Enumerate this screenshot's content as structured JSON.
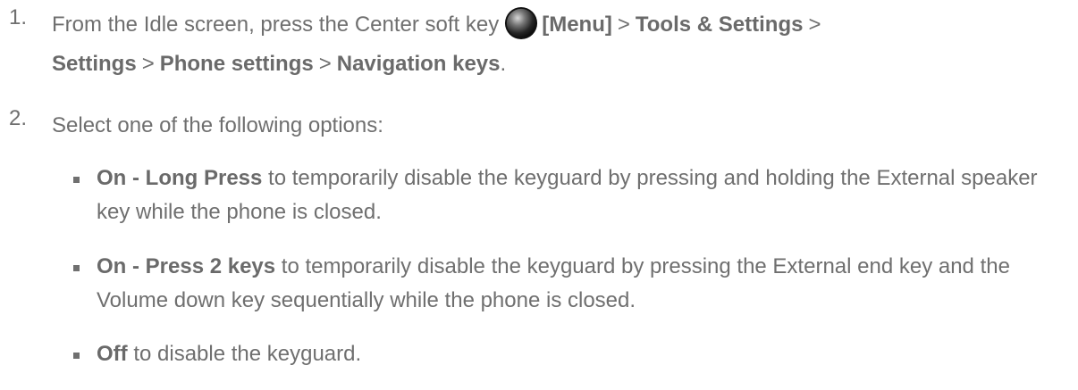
{
  "steps": [
    {
      "number": "1.",
      "text_before_icon": "From the Idle screen, press the Center soft key",
      "icon": "center-soft-key-icon",
      "menu_label": "[Menu]",
      "separator": ">",
      "path": [
        "Tools & Settings",
        "Settings",
        "Phone settings",
        "Navigation keys"
      ],
      "end_punct": "."
    },
    {
      "number": "2.",
      "text": "Select one of the following options:"
    }
  ],
  "options": [
    {
      "label": "On - Long Press",
      "description": " to temporarily disable the keyguard by pressing and holding the External speaker key while the phone is closed."
    },
    {
      "label": "On - Press 2 keys",
      "description": " to temporarily disable the keyguard by pressing the External end key and the Volume down key sequentially while the phone is closed."
    },
    {
      "label": "Off",
      "description": " to disable the keyguard."
    }
  ],
  "colors": {
    "text": "#6f6f6f",
    "bullet": "#707070",
    "icon_dark": "#1a1a1a",
    "icon_highlight": "#bdbdbd"
  }
}
